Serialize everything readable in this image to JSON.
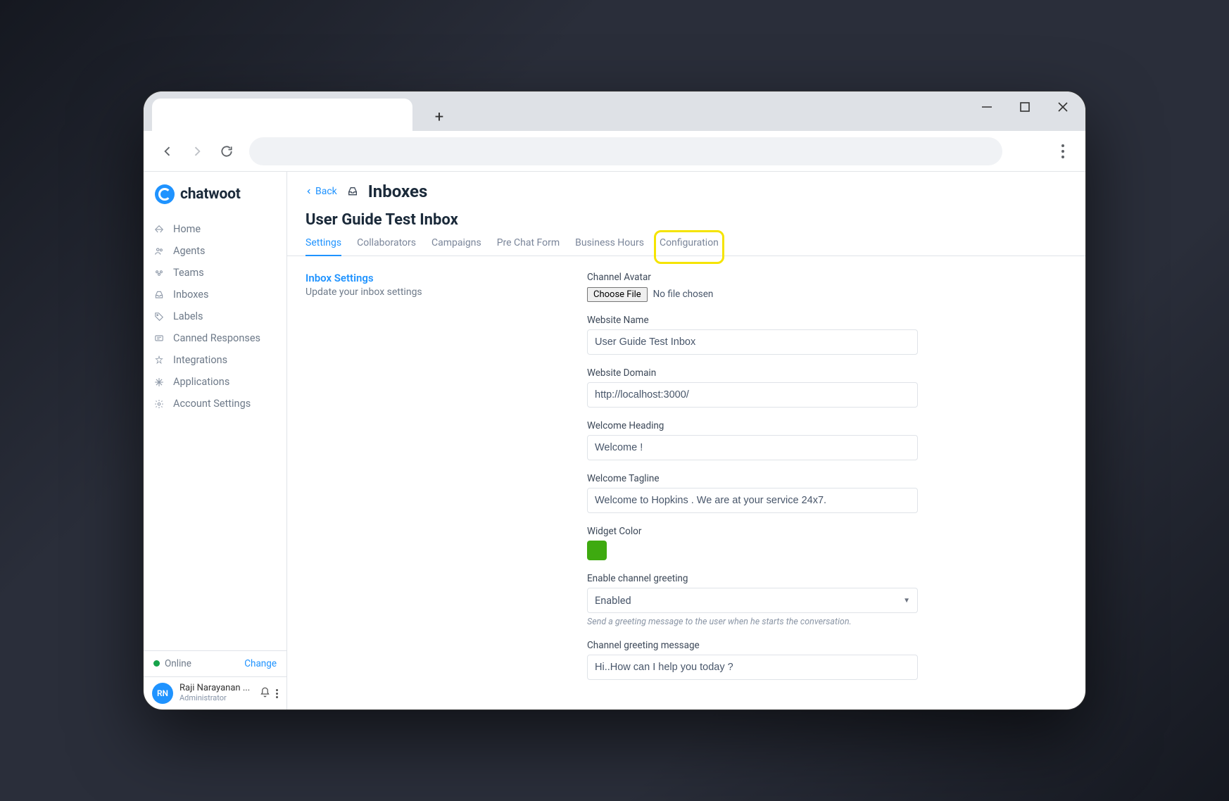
{
  "browser": {
    "window_buttons": {
      "min": "minimize",
      "max": "maximize",
      "close": "close"
    }
  },
  "brand": "chatwoot",
  "sidebar": {
    "items": [
      {
        "icon": "home",
        "label": "Home"
      },
      {
        "icon": "agents",
        "label": "Agents"
      },
      {
        "icon": "teams",
        "label": "Teams"
      },
      {
        "icon": "inboxes",
        "label": "Inboxes"
      },
      {
        "icon": "labels",
        "label": "Labels"
      },
      {
        "icon": "canned",
        "label": "Canned Responses"
      },
      {
        "icon": "integrations",
        "label": "Integrations"
      },
      {
        "icon": "applications",
        "label": "Applications"
      },
      {
        "icon": "account",
        "label": "Account Settings"
      }
    ],
    "presence": {
      "status": "Online",
      "change": "Change"
    },
    "profile": {
      "initials": "RN",
      "name": "Raji Narayanan ...",
      "role": "Administrator"
    }
  },
  "header": {
    "back": "Back",
    "title": "Inboxes",
    "inbox_name": "User Guide Test Inbox",
    "tabs": [
      "Settings",
      "Collaborators",
      "Campaigns",
      "Pre Chat Form",
      "Business Hours",
      "Configuration"
    ],
    "active_tab_index": 0,
    "highlight_tab_index": 5
  },
  "section": {
    "title": "Inbox Settings",
    "subtitle": "Update your inbox settings"
  },
  "form": {
    "channel_avatar": {
      "label": "Channel Avatar",
      "button": "Choose File",
      "status": "No file chosen"
    },
    "website_name": {
      "label": "Website Name",
      "value": "User Guide Test Inbox"
    },
    "website_domain": {
      "label": "Website Domain",
      "value": "http://localhost:3000/"
    },
    "welcome_heading": {
      "label": "Welcome Heading",
      "value": "Welcome !"
    },
    "welcome_tagline": {
      "label": "Welcome Tagline",
      "value": "Welcome to Hopkins . We are at your service 24x7."
    },
    "widget_color": {
      "label": "Widget Color",
      "value": "#3eaa10"
    },
    "greeting": {
      "label": "Enable channel greeting",
      "value": "Enabled",
      "hint": "Send a greeting message to the user when he starts the conversation."
    },
    "greeting_msg": {
      "label": "Channel greeting message",
      "value": "Hi..How can I help you today ?"
    }
  }
}
